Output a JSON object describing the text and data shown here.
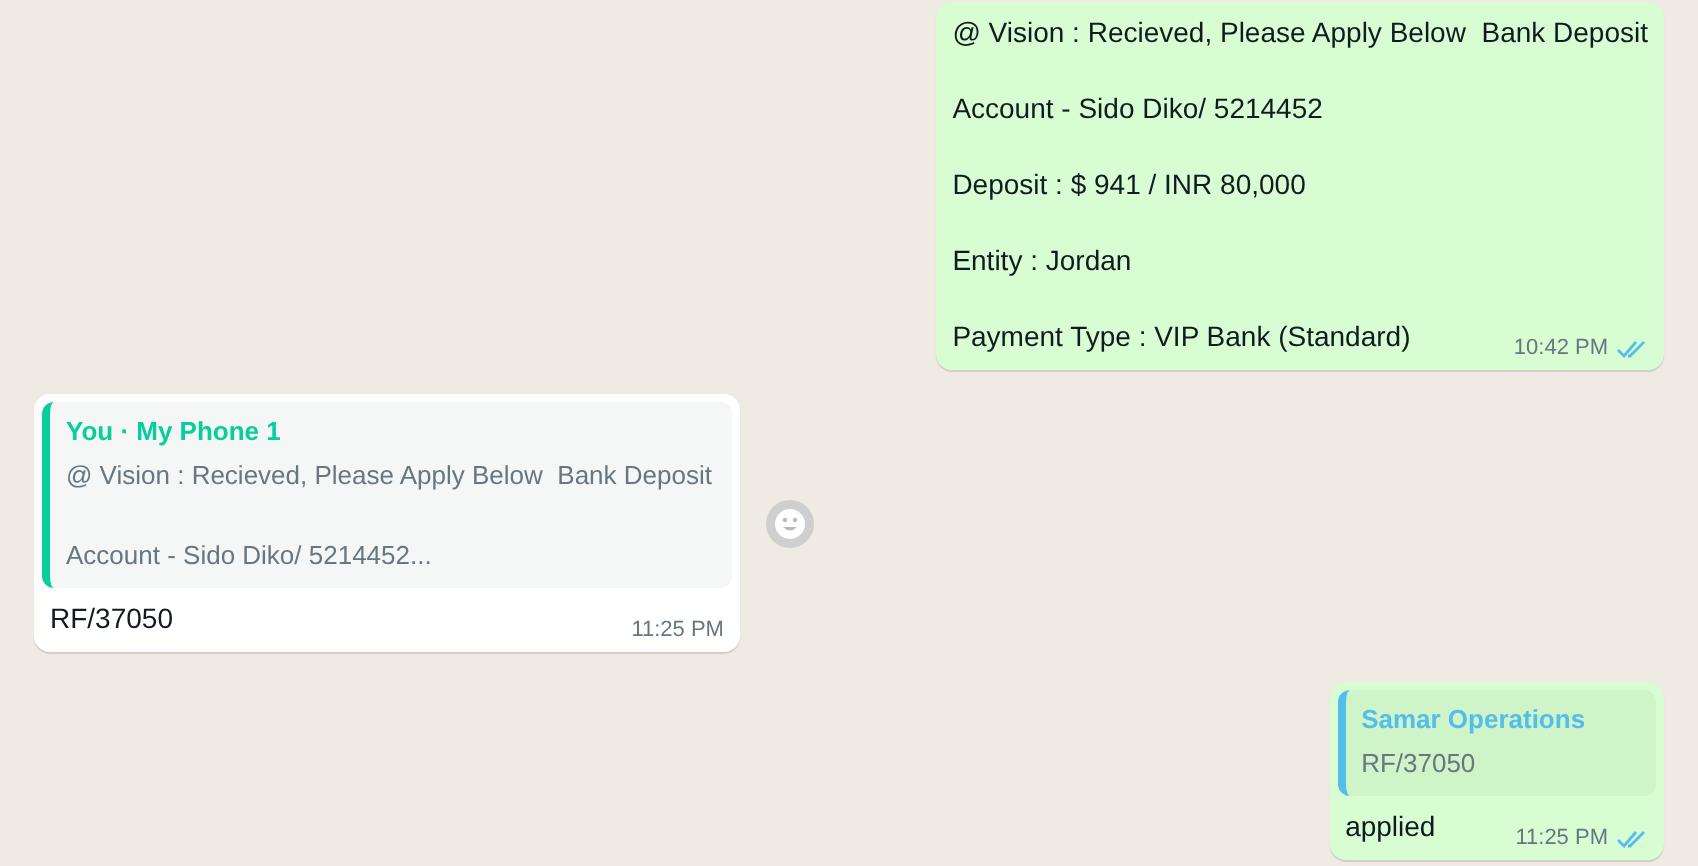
{
  "messages": [
    {
      "kind": "outgoing",
      "lines": [
        "@ Vision : Recieved, Please Apply Below  Bank Deposit",
        "Account - Sido Diko/ 5214452",
        "Deposit : $ 941 / INR 80,000",
        "Entity : Jordan",
        "Payment Type : VIP Bank (Standard)"
      ],
      "time": "10:42 PM",
      "read": true
    },
    {
      "kind": "incoming",
      "quote": {
        "author": "You · My Phone 1",
        "lines": [
          "@ Vision : Recieved, Please Apply Below  Bank Deposit",
          "Account - Sido Diko/ 5214452..."
        ],
        "color": "#06cf9c"
      },
      "lines": [
        "RF/37050"
      ],
      "time": "11:25 PM",
      "react_button": true
    },
    {
      "kind": "outgoing",
      "quote": {
        "author": "Samar Operations",
        "lines": [
          "RF/37050"
        ],
        "color": "#53bdeb"
      },
      "lines": [
        "applied"
      ],
      "time": "11:25 PM",
      "read": true
    }
  ]
}
